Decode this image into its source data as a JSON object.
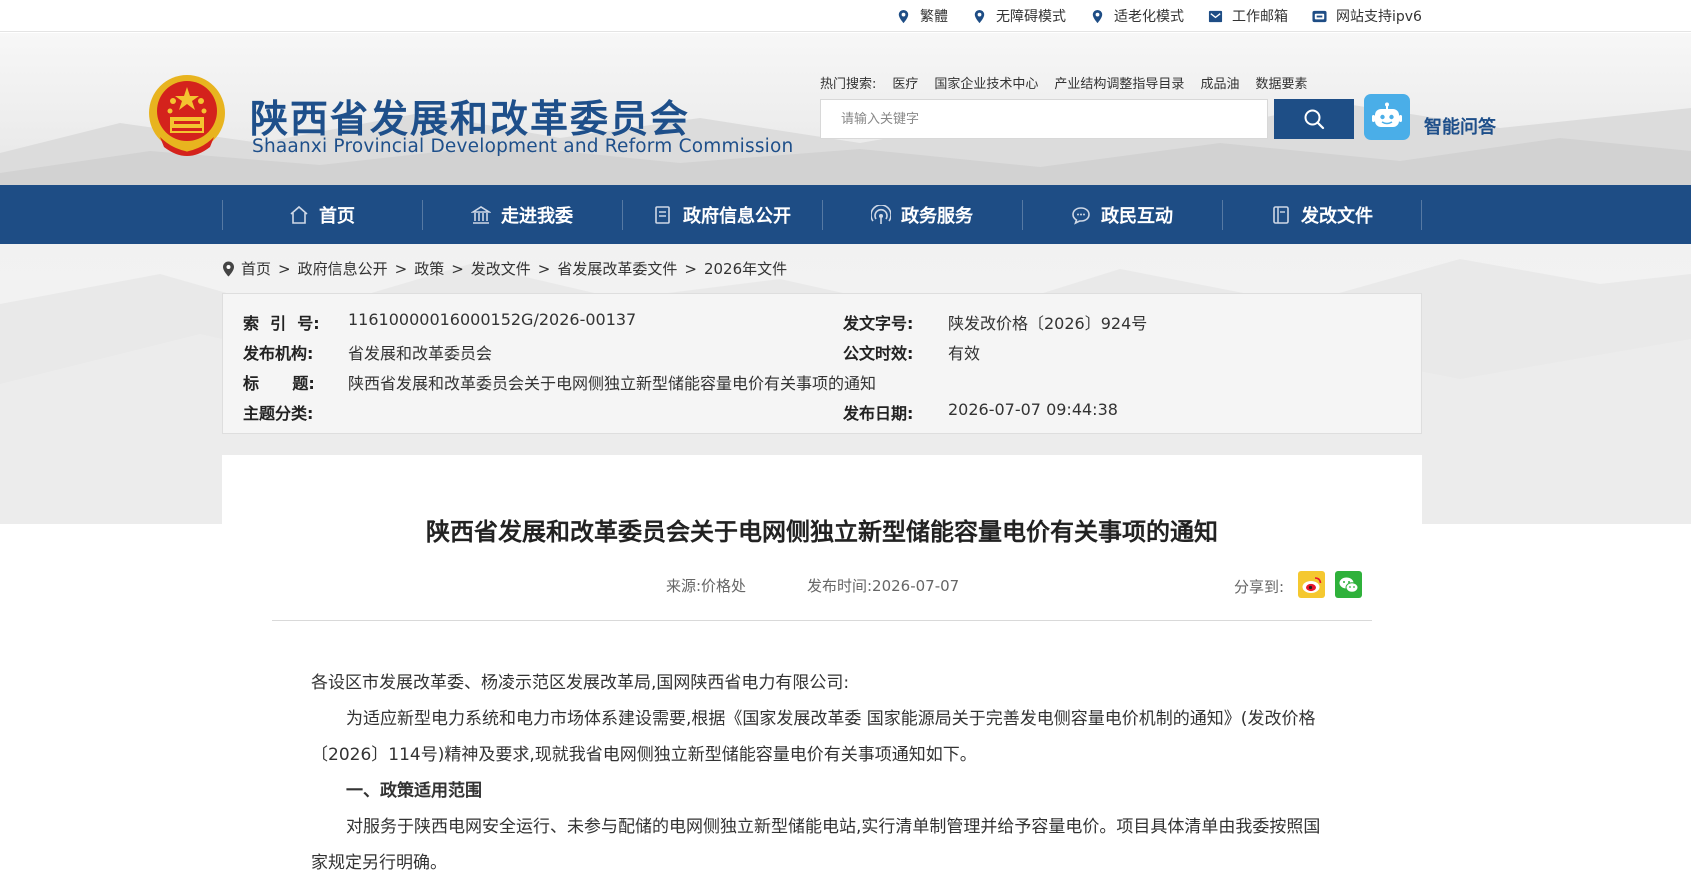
{
  "topbar": {
    "links": [
      {
        "label": "繁體",
        "icon": "location-pin-icon"
      },
      {
        "label": "无障碍模式",
        "icon": "location-pin-icon"
      },
      {
        "label": "适老化模式",
        "icon": "location-pin-icon"
      },
      {
        "label": "工作邮箱",
        "icon": "mail-icon"
      },
      {
        "label": "网站支持ipv6",
        "icon": "ipv6-icon"
      }
    ]
  },
  "header": {
    "title_cn": "陕西省发展和改革委员会",
    "title_en": "Shaanxi Provincial Development and Reform Commission",
    "hot_label": "热门搜索:",
    "hot_items": [
      "医疗",
      "国家企业技术中心",
      "产业结构调整指导目录",
      "成品油",
      "数据要素"
    ],
    "search_placeholder": "请输入关键字",
    "assistant_label": "智能问答"
  },
  "nav": {
    "items": [
      {
        "label": "首页",
        "icon": "home-icon"
      },
      {
        "label": "走进我委",
        "icon": "building-icon"
      },
      {
        "label": "政府信息公开",
        "icon": "document-icon"
      },
      {
        "label": "政务服务",
        "icon": "signal-icon"
      },
      {
        "label": "政民互动",
        "icon": "chat-icon"
      },
      {
        "label": "发改文件",
        "icon": "file-icon"
      }
    ]
  },
  "breadcrumb": [
    "首页",
    "政府信息公开",
    "政策",
    "发改文件",
    "省发展改革委文件",
    "2026年文件"
  ],
  "meta": {
    "index_label": "索  引  号:",
    "index_value": "11610000016000152G/2026-00137",
    "doc_no_label": "发文字号:",
    "doc_no_value": "陕发改价格〔2026〕924号",
    "publisher_label": "发布机构:",
    "publisher_value": "省发展和改革委员会",
    "validity_label": "公文时效:",
    "validity_value": "有效",
    "title_label": "标      题:",
    "title_value": "陕西省发展和改革委员会关于电网侧独立新型储能容量电价有关事项的通知",
    "topic_label": "主题分类:",
    "date_label": "发布日期:",
    "date_value": "2026-07-07 09:44:38"
  },
  "article": {
    "title": "陕西省发展和改革委员会关于电网侧独立新型储能容量电价有关事项的通知",
    "source": "来源:价格处",
    "publish_time": "发布时间:2026-07-07",
    "share_label": "分享到:",
    "paragraphs": [
      "各设区市发展改革委、杨凌示范区发展改革局,国网陕西省电力有限公司:",
      "为适应新型电力系统和电力市场体系建设需要,根据《国家发展改革委 国家能源局关于完善发电侧容量电价机制的通知》(发改价格〔2026〕114号)精神及要求,现就我省电网侧独立新型储能容量电价有关事项通知如下。",
      "一、政策适用范围",
      "对服务于陕西电网安全运行、未参与配储的电网侧独立新型储能电站,实行清单制管理并给予容量电价。项目具体清单由我委按照国家规定另行明确。"
    ]
  },
  "colors": {
    "brand_blue": "#1e4d85",
    "assistant_blue": "#4aaee8",
    "weibo_yellow": "#f5c830",
    "wechat_green": "#2fb13b"
  }
}
